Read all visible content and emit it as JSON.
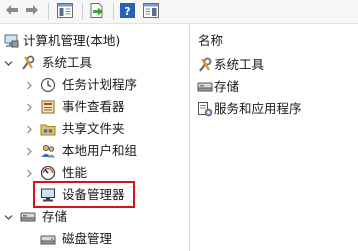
{
  "toolbar": {
    "buttons": [
      {
        "icon": "back-arrow-icon"
      },
      {
        "icon": "forward-arrow-icon"
      },
      {
        "icon": "console-tree-icon"
      },
      {
        "icon": "export-list-icon"
      },
      {
        "icon": "help-icon"
      },
      {
        "icon": "show-hide-action-pane-icon"
      }
    ]
  },
  "tree": {
    "root": {
      "label": "计算机管理(本地)"
    },
    "system_tools": {
      "label": "系统工具"
    },
    "task_scheduler": {
      "label": "任务计划程序"
    },
    "event_viewer": {
      "label": "事件查看器"
    },
    "shared_folders": {
      "label": "共享文件夹"
    },
    "local_users": {
      "label": "本地用户和组"
    },
    "performance": {
      "label": "性能"
    },
    "device_manager": {
      "label": "设备管理器"
    },
    "storage": {
      "label": "存储"
    },
    "disk_management": {
      "label": "磁盘管理"
    }
  },
  "list": {
    "column_header": "名称",
    "items": [
      {
        "label": "系统工具",
        "icon": "system-tools-icon"
      },
      {
        "label": "存储",
        "icon": "storage-icon"
      },
      {
        "label": "服务和应用程序",
        "icon": "services-apps-icon"
      }
    ]
  },
  "colors": {
    "highlight_border": "#d9131b",
    "accent_blue": "#1f6fc5"
  }
}
